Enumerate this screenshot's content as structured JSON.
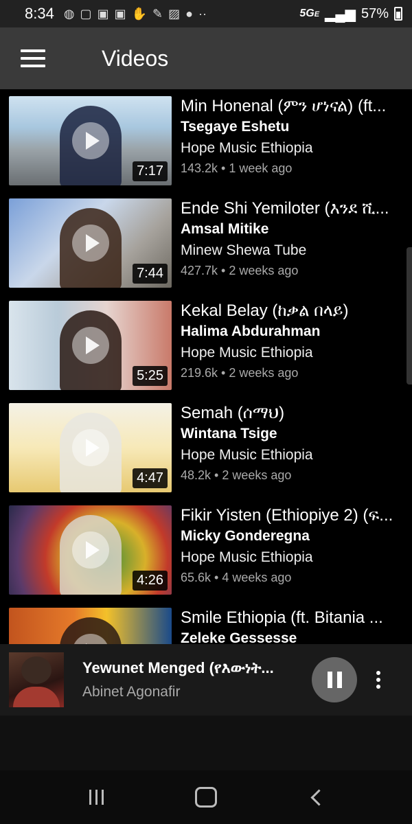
{
  "status_bar": {
    "time": "8:34",
    "network": "5G",
    "network_sub": "E",
    "battery": "57%"
  },
  "app_bar": {
    "title": "Videos"
  },
  "videos": [
    {
      "title": "Min Honenal (ምን ሆነናል) (ft...",
      "artist": "Tsegaye Eshetu",
      "channel": "Hope Music Ethiopia",
      "stats": "143.2k • 1 week ago",
      "duration": "7:17"
    },
    {
      "title": "Ende Shi Yemiloter (እንደ ሺ...",
      "artist": "Amsal Mitike",
      "channel": "Minew Shewa Tube",
      "stats": "427.7k • 2 weeks ago",
      "duration": "7:44"
    },
    {
      "title": "Kekal Belay (ከቃል በላይ)",
      "artist": "Halima Abdurahman",
      "channel": "Hope Music Ethiopia",
      "stats": "219.6k • 2 weeks ago",
      "duration": "5:25"
    },
    {
      "title": "Semah (ሰማህ)",
      "artist": "Wintana Tsige",
      "channel": "Hope Music Ethiopia",
      "stats": "48.2k • 2 weeks ago",
      "duration": "4:47"
    },
    {
      "title": "Fikir Yisten (Ethiopiye 2) (ፍ...",
      "artist": "Micky Gonderegna",
      "channel": "Hope Music Ethiopia",
      "stats": "65.6k • 4 weeks ago",
      "duration": "4:26"
    },
    {
      "title": "Smile Ethiopia (ft. Bitania ...",
      "artist": "Zeleke Gessesse",
      "channel": "",
      "stats": "",
      "duration": ""
    }
  ],
  "mini_player": {
    "title": "Yewunet Menged (የእውነት...",
    "artist": "Abinet Agonafir"
  },
  "colors": {
    "background": "#000000",
    "app_bar": "#3a3a3a",
    "mini_player": "#1a1a1a",
    "secondary_text": "#aaaaaa"
  }
}
